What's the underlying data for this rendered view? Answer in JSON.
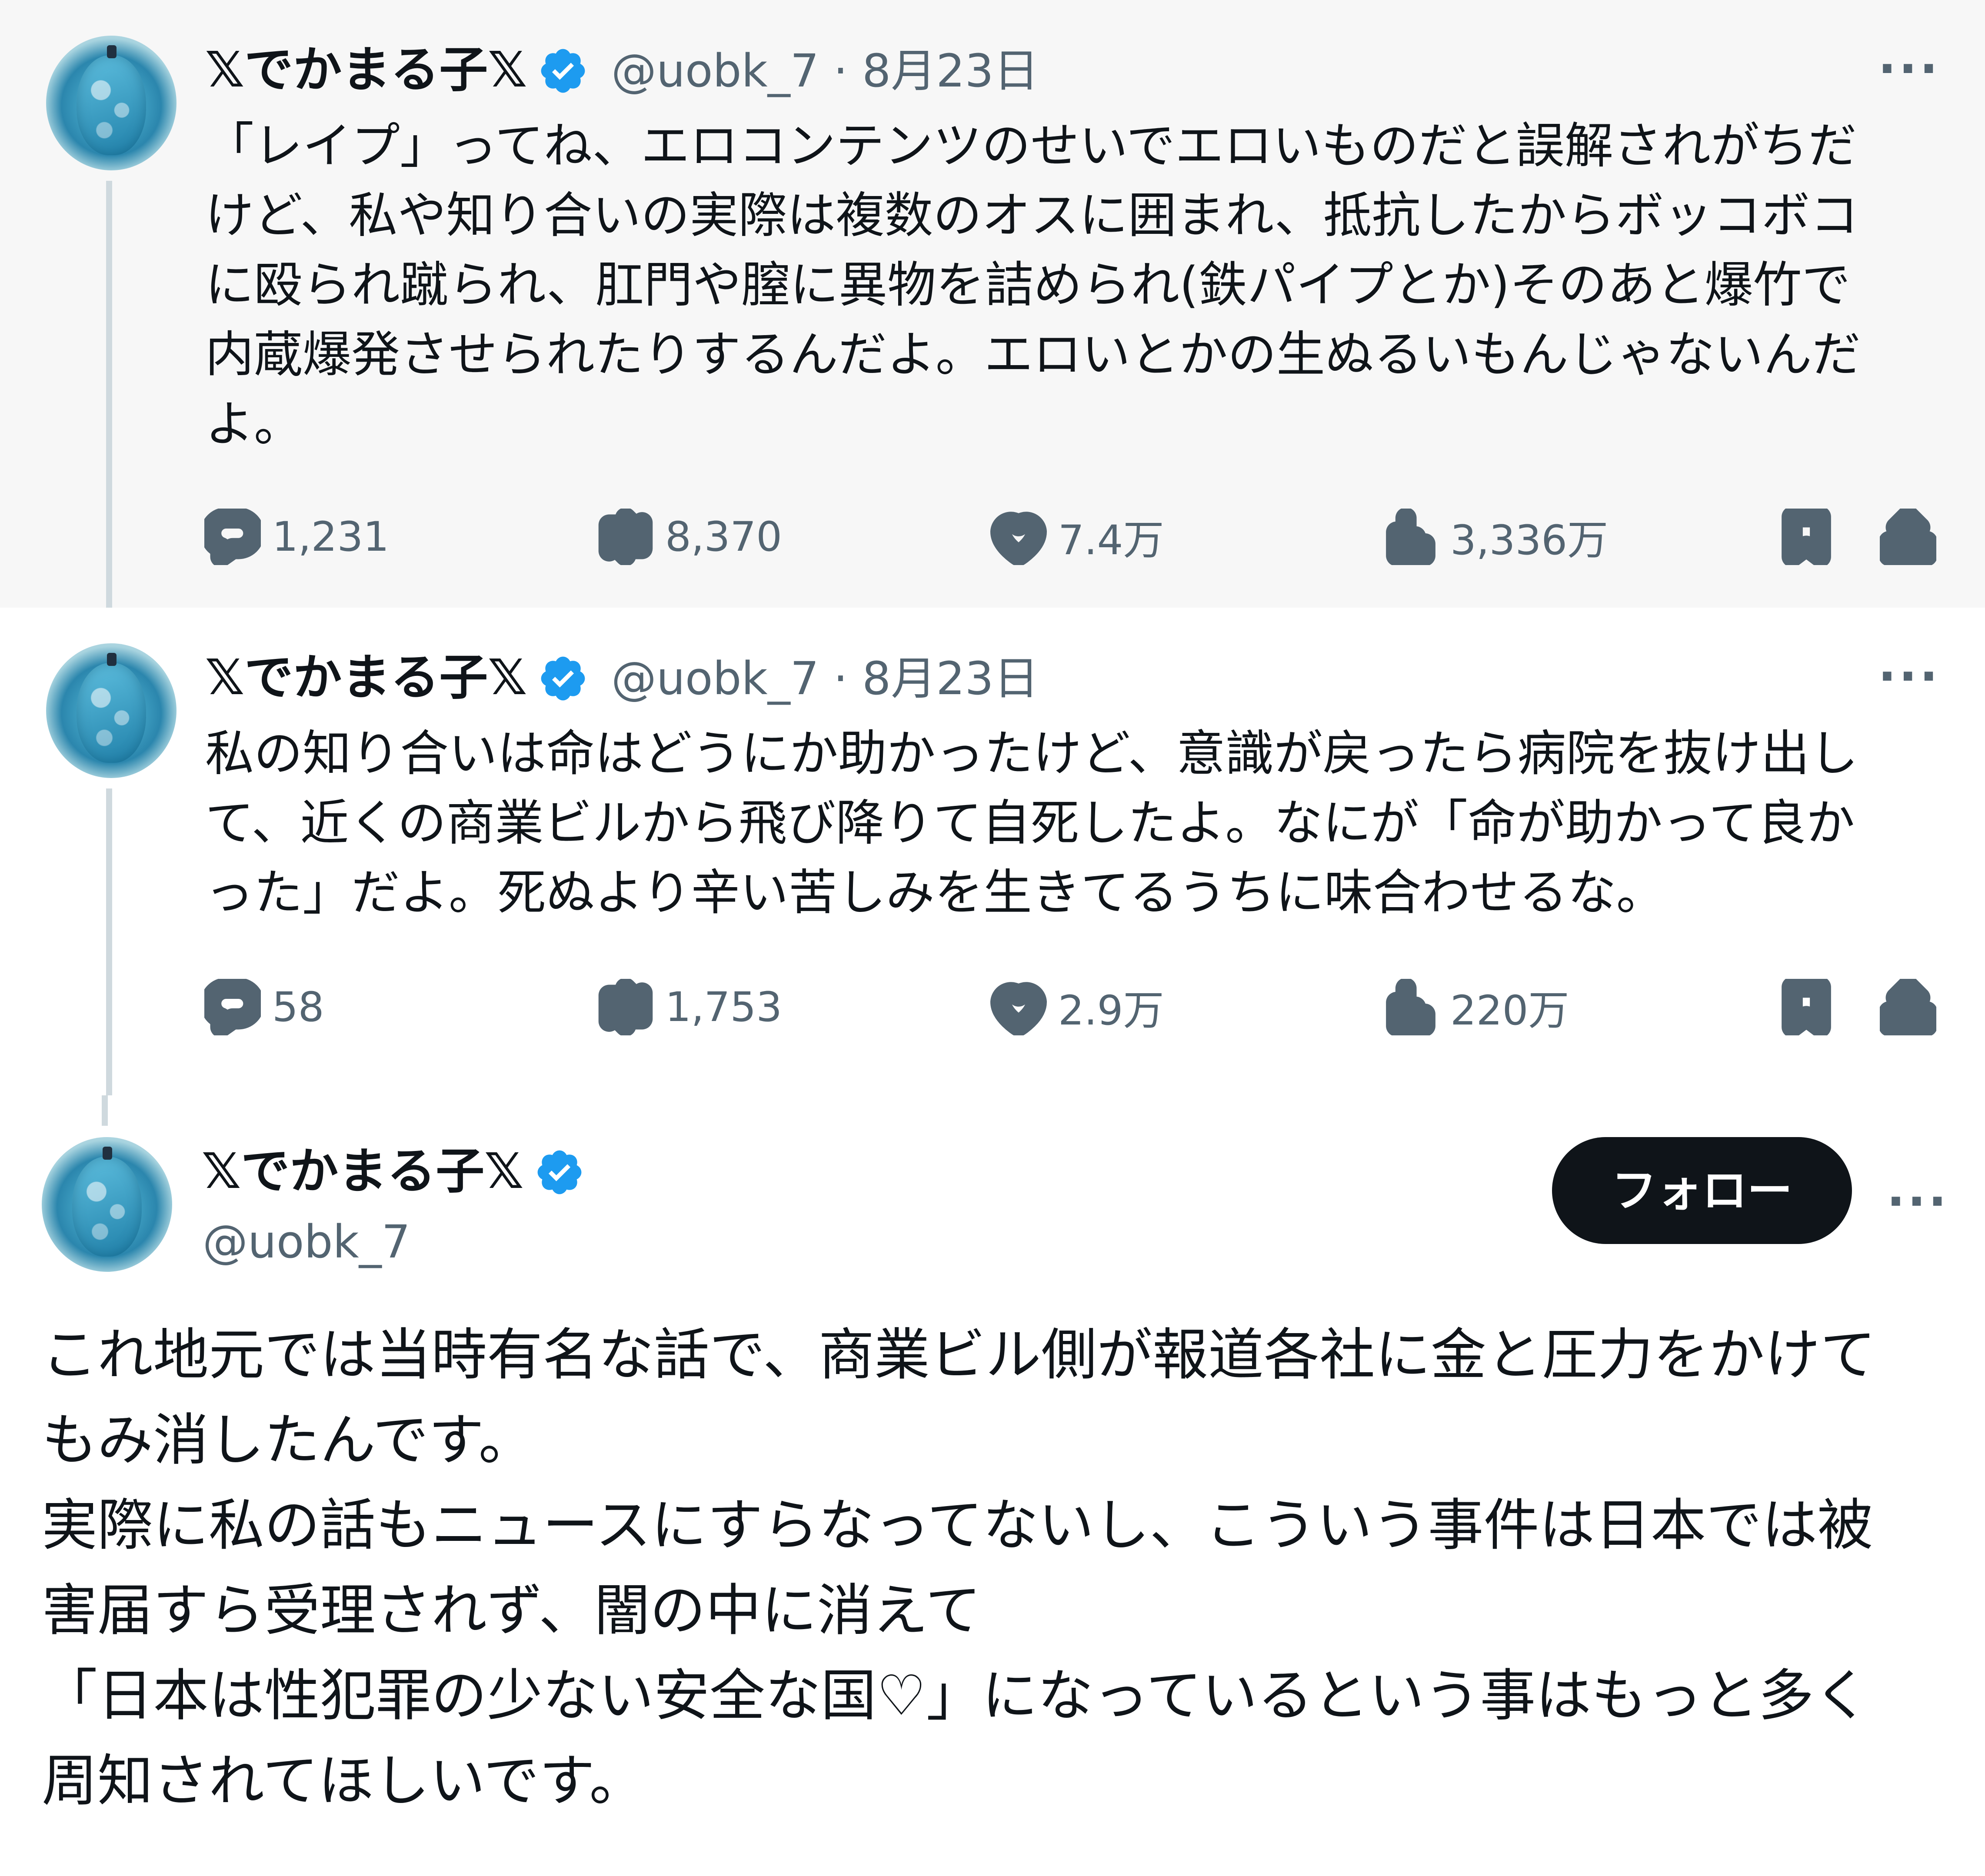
{
  "tweets": [
    {
      "display_name": "𝕏でかまる子𝕏",
      "handle": "@uobk_7",
      "date": "8月23日",
      "handle_date": "@uobk_7 · 8月23日",
      "more_label": "···",
      "text": "「レイプ」ってね、エロコンテンツのせいでエロいものだと誤解されがちだ\nけど、私や知り合いの実際は複数のオスに囲まれ、抵抗したからボッコボコ\nに殴られ蹴られ、肛門や膣に異物を詰められ(鉄パイプとか)そのあと爆竹で\n内蔵爆発させられたりするんだよ。エロいとかの生ぬるいもんじゃないんだ\nよ。",
      "stats": {
        "replies": "1,231",
        "reposts": "8,370",
        "likes": "7.4万",
        "views": "3,336万"
      }
    },
    {
      "display_name": "𝕏でかまる子𝕏",
      "handle": "@uobk_7",
      "date": "8月23日",
      "handle_date": "@uobk_7 · 8月23日",
      "more_label": "···",
      "text": "私の知り合いは命はどうにか助かったけど、意識が戻ったら病院を抜け出し\nて、近くの商業ビルから飛び降りて自死したよ。なにが「命が助かって良か\nった」だよ。死ぬより辛い苦しみを生きてるうちに味合わせるな。",
      "stats": {
        "replies": "58",
        "reposts": "1,753",
        "likes": "2.9万",
        "views": "220万"
      }
    }
  ],
  "main_tweet": {
    "display_name": "𝕏でかまる子𝕏",
    "handle": "@uobk_7",
    "follow_label": "フォロー",
    "more_label": "···",
    "text": "これ地元では当時有名な話で、商業ビル側が報道各社に金と圧力をかけて\nもみ消したんです。\n実際に私の話もニュースにすらなってないし、こういう事件は日本では被\n害届すら受理されず、闇の中に消えて\n「日本は性犯罪の少ない安全な国♡」になっているという事はもっと多く\n周知されてほしいです。"
  },
  "icons": {
    "reply": "reply-bubble-icon",
    "repost": "repost-arrows-icon",
    "like": "heart-icon",
    "views": "views-bar-chart-icon",
    "bookmark": "bookmark-icon",
    "share": "share-upload-icon",
    "verified": "verified-badge-icon"
  },
  "colors": {
    "text": "#0f1419",
    "secondary": "#536471",
    "verified": "#1d9bf0",
    "highlight_bg": "#f7f7f7",
    "thread_line": "#cfd9de",
    "follow_bg": "#0f1419"
  }
}
